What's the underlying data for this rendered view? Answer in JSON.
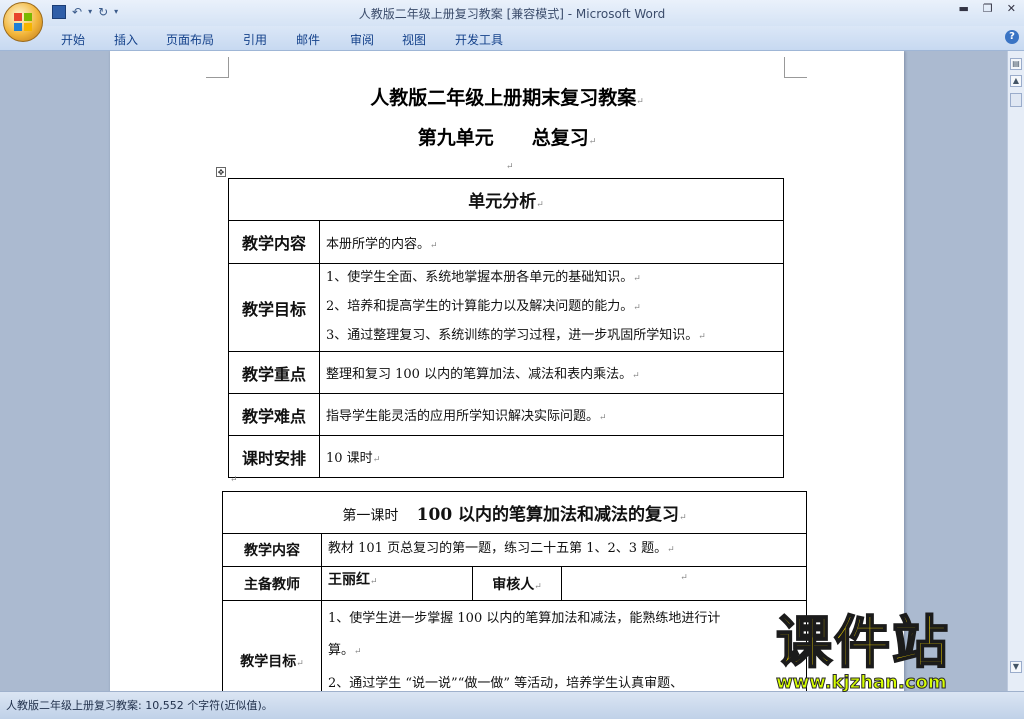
{
  "window": {
    "title": "人教版二年级上册复习教案 [兼容模式] - Microsoft Word",
    "controls": [
      "minimize-icon",
      "restore-icon",
      "close-icon"
    ]
  },
  "qat": {
    "save_icon": "save-icon",
    "undo_icon": "undo-icon",
    "redo_icon": "redo-icon",
    "customize_icon": "customize-icon"
  },
  "ribbon": {
    "tabs": [
      "开始",
      "插入",
      "页面布局",
      "引用",
      "邮件",
      "审阅",
      "视图",
      "开发工具"
    ],
    "help_label": "?"
  },
  "document": {
    "title": "人教版二年级上册期末复习教案",
    "subtitle_left": "第九单元",
    "subtitle_right": "总复习",
    "unit_table": {
      "header": "单元分析",
      "rows": [
        {
          "label": "教学内容",
          "lines": [
            "本册所学的内容。"
          ]
        },
        {
          "label": "教学目标",
          "lines": [
            "1、使学生全面、系统地掌握本册各单元的基础知识。",
            "2、培养和提高学生的计算能力以及解决问题的能力。",
            "3、通过整理复习、系统训练的学习过程，进一步巩固所学知识。"
          ]
        },
        {
          "label": "教学重点",
          "lines": [
            "整理和复习 100 以内的笔算加法、减法和表内乘法。"
          ]
        },
        {
          "label": "教学难点",
          "lines": [
            "指导学生能灵活的应用所学知识解决实际问题。"
          ]
        },
        {
          "label": "课时安排",
          "lines": [
            "10 课时"
          ]
        }
      ]
    },
    "lesson_table": {
      "header_prefix": "第一课时",
      "header_title": "100 以内的笔算加法和减法的复习",
      "content_label": "教学内容",
      "content": "教材 101 页总复习的第一题，练习二十五第 1、2、3 题。",
      "teacher_label": "主备教师",
      "teacher": "王丽红",
      "reviewer_label": "审核人",
      "reviewer": "",
      "goal_label": "教学目标",
      "goal_lines": [
        "1、使学生进一步掌握 100 以内的笔算加法和减法，能熟练地进行计",
        "算。",
        "2、通过学生 “说一说”“做一做” 等活动，培养学生认真审题、"
      ]
    }
  },
  "statusbar": {
    "text": "人教版二年级上册复习教案: 10,552 个字符(近似值)。"
  },
  "watermark": {
    "text": "课件站",
    "url": "www.kjzhan.com"
  }
}
